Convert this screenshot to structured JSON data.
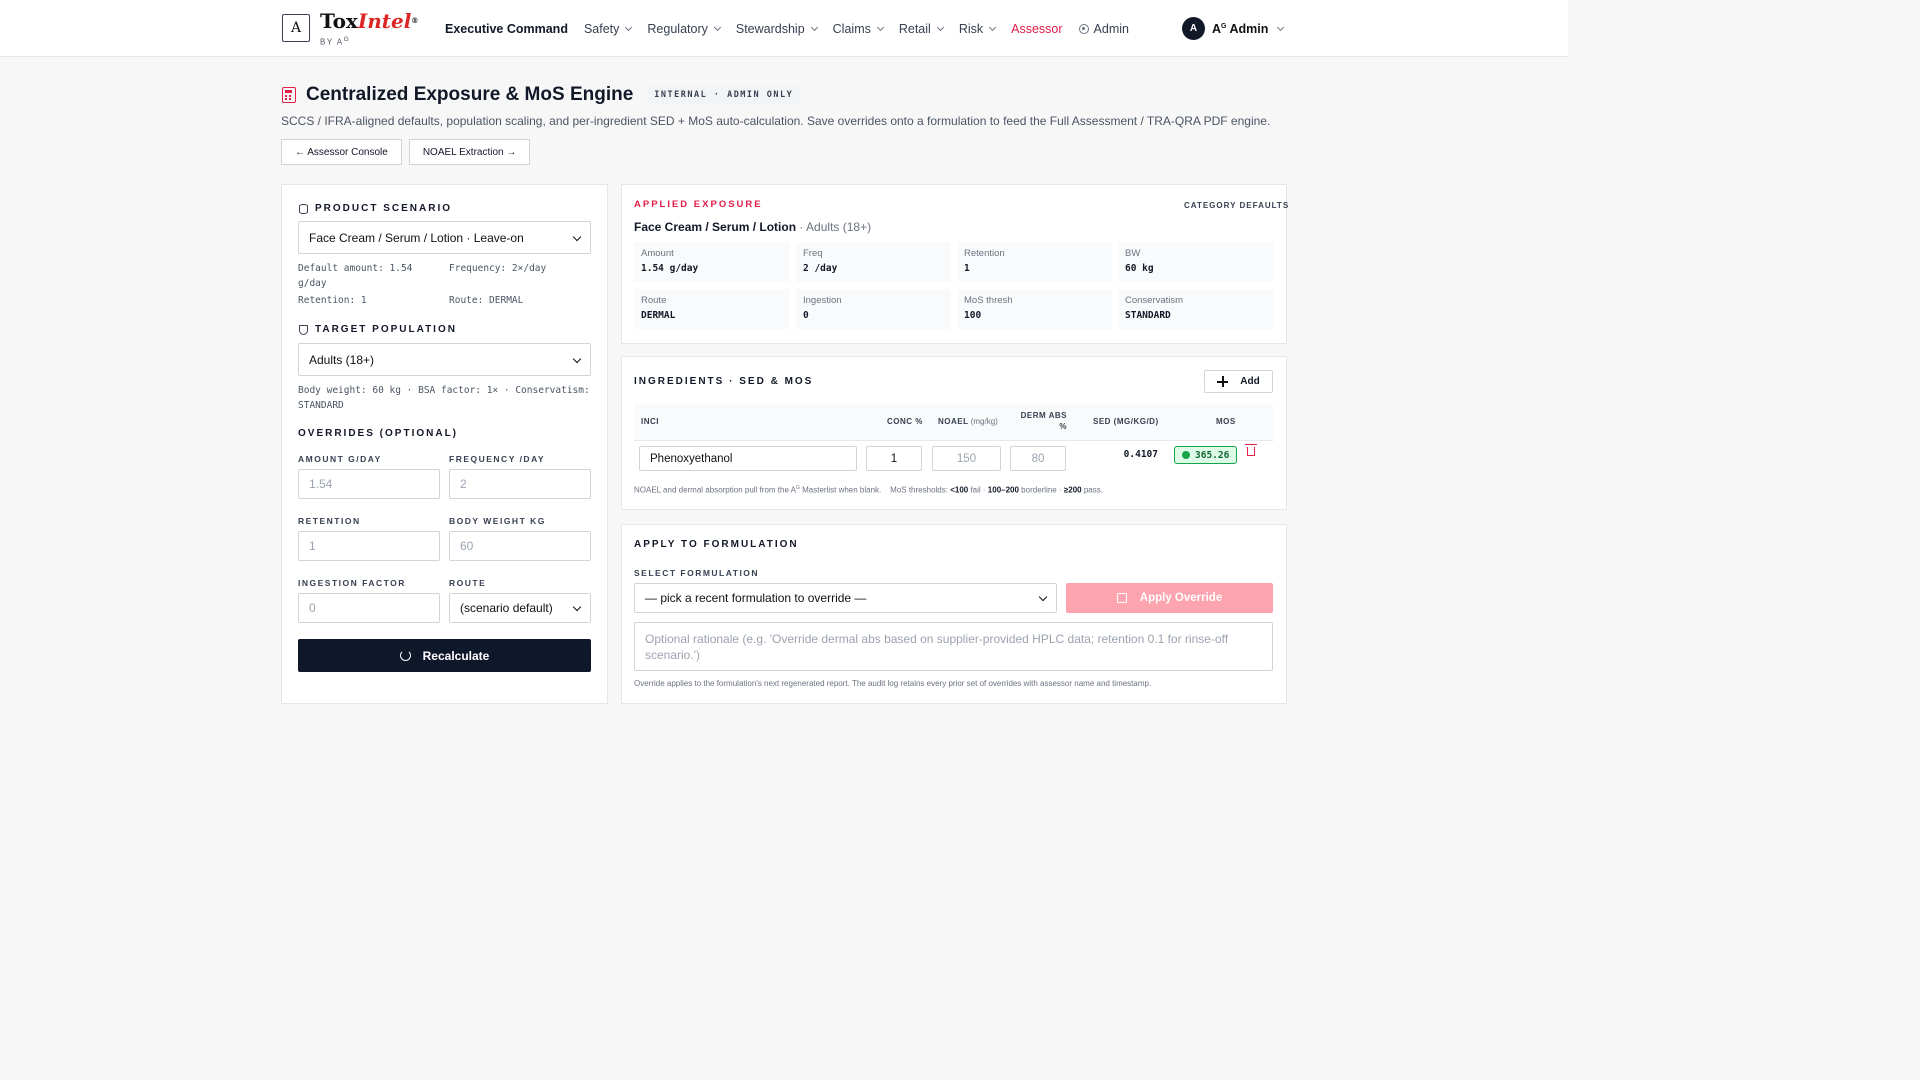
{
  "header": {
    "brand_main": "Tox",
    "brand_accent": "Intel",
    "brand_mark": "®",
    "brand_by": "BY A",
    "brand_by_sup": "G",
    "logo_glyph": "A",
    "nav": [
      {
        "label": "Executive Command"
      },
      {
        "label": "Safety"
      },
      {
        "label": "Regulatory"
      },
      {
        "label": "Stewardship"
      },
      {
        "label": "Claims"
      },
      {
        "label": "Retail"
      },
      {
        "label": "Risk"
      },
      {
        "label": "Assessor"
      },
      {
        "label": "Admin"
      }
    ],
    "user_initial": "A",
    "user_name_prefix": "A",
    "user_name_sup": "G",
    "user_name_suffix": " Admin"
  },
  "page": {
    "title": "Centralized Exposure & MoS Engine",
    "badge": "INTERNAL · ADMIN ONLY",
    "subtitle": "SCCS / IFRA-aligned defaults, population scaling, and per-ingredient SED + MoS auto-calculation. Save overrides onto a formulation to feed the Full Assessment / TRA-QRA PDF engine.",
    "btn_console": "← Assessor Console",
    "btn_noael": "NOAEL Extraction →"
  },
  "scenario": {
    "heading": "PRODUCT SCENARIO",
    "selected": "Face Cream / Serum / Lotion · Leave-on",
    "default_amount": "Default amount: 1.54 g/day",
    "frequency": "Frequency: 2×/day",
    "retention": "Retention: 1",
    "route": "Route: DERMAL"
  },
  "population": {
    "heading": "TARGET POPULATION",
    "selected": "Adults (18+)",
    "meta": "Body weight: 60 kg · BSA factor: 1× · Conservatism: STANDARD"
  },
  "overrides": {
    "heading": "OVERRIDES (OPTIONAL)",
    "amount_label": "AMOUNT G/DAY",
    "amount_placeholder": "1.54",
    "frequency_label": "FREQUENCY /DAY",
    "frequency_placeholder": "2",
    "retention_label": "RETENTION",
    "retention_placeholder": "1",
    "bw_label": "BODY WEIGHT KG",
    "bw_placeholder": "60",
    "ingestion_label": "INGESTION FACTOR",
    "ingestion_placeholder": "0",
    "route_label": "ROUTE",
    "route_selected": "(scenario default)",
    "recalc": "Recalculate"
  },
  "applied": {
    "kicker": "APPLIED EXPOSURE",
    "defaults_label": "CATEGORY DEFAULTS",
    "product": "Face Cream / Serum / Lotion",
    "population": " · Adults (18+)",
    "cells": [
      {
        "k": "Amount",
        "v": "1.54 g/day"
      },
      {
        "k": "Freq",
        "v": "2 /day"
      },
      {
        "k": "Retention",
        "v": "1"
      },
      {
        "k": "BW",
        "v": "60 kg"
      },
      {
        "k": "Route",
        "v": "DERMAL"
      },
      {
        "k": "Ingestion",
        "v": "0"
      },
      {
        "k": "MoS thresh",
        "v": "100"
      },
      {
        "k": "Conservatism",
        "v": "STANDARD"
      }
    ]
  },
  "ingredients": {
    "heading": "INGREDIENTS · SED & MOS",
    "add": "Add",
    "col_inci": "INCI",
    "col_conc": "CONC %",
    "col_noael": "NOAEL",
    "col_noael_unit": " (mg/kg)",
    "col_derm": "DERM ABS %",
    "col_sed": "SED (MG/KG/D)",
    "col_mos": "MOS",
    "rows": [
      {
        "inci": "Phenoxyethanol",
        "conc": "1",
        "noael": "150",
        "derm": "80",
        "sed": "0.4107",
        "mos": "365.26"
      }
    ],
    "note_prefix": "NOAEL and dermal absorption pull from the A",
    "note_sup": "G",
    "note_mid": " Masterlist when blank.    MoS thresholds: ",
    "note_fail": "<100",
    "note_fail_txt": " fail · ",
    "note_border": "100–200",
    "note_border_txt": " borderline · ",
    "note_pass": "≥200",
    "note_pass_txt": " pass."
  },
  "apply": {
    "heading": "APPLY TO FORMULATION",
    "select_label": "SELECT FORMULATION",
    "select_value": "— pick a recent formulation to override —",
    "btn": "Apply Override",
    "rationale_placeholder": "Optional rationale (e.g. 'Override dermal abs based on supplier-provided HPLC data; retention 0.1 for rinse-off scenario.')",
    "footnote": "Override applies to the formulation's next regenerated report. The audit log retains every prior set of overrides with assessor name and timestamp."
  },
  "colors": {
    "accent": "#e11d48",
    "dark": "#0f172a",
    "pass": "#16a34a"
  }
}
